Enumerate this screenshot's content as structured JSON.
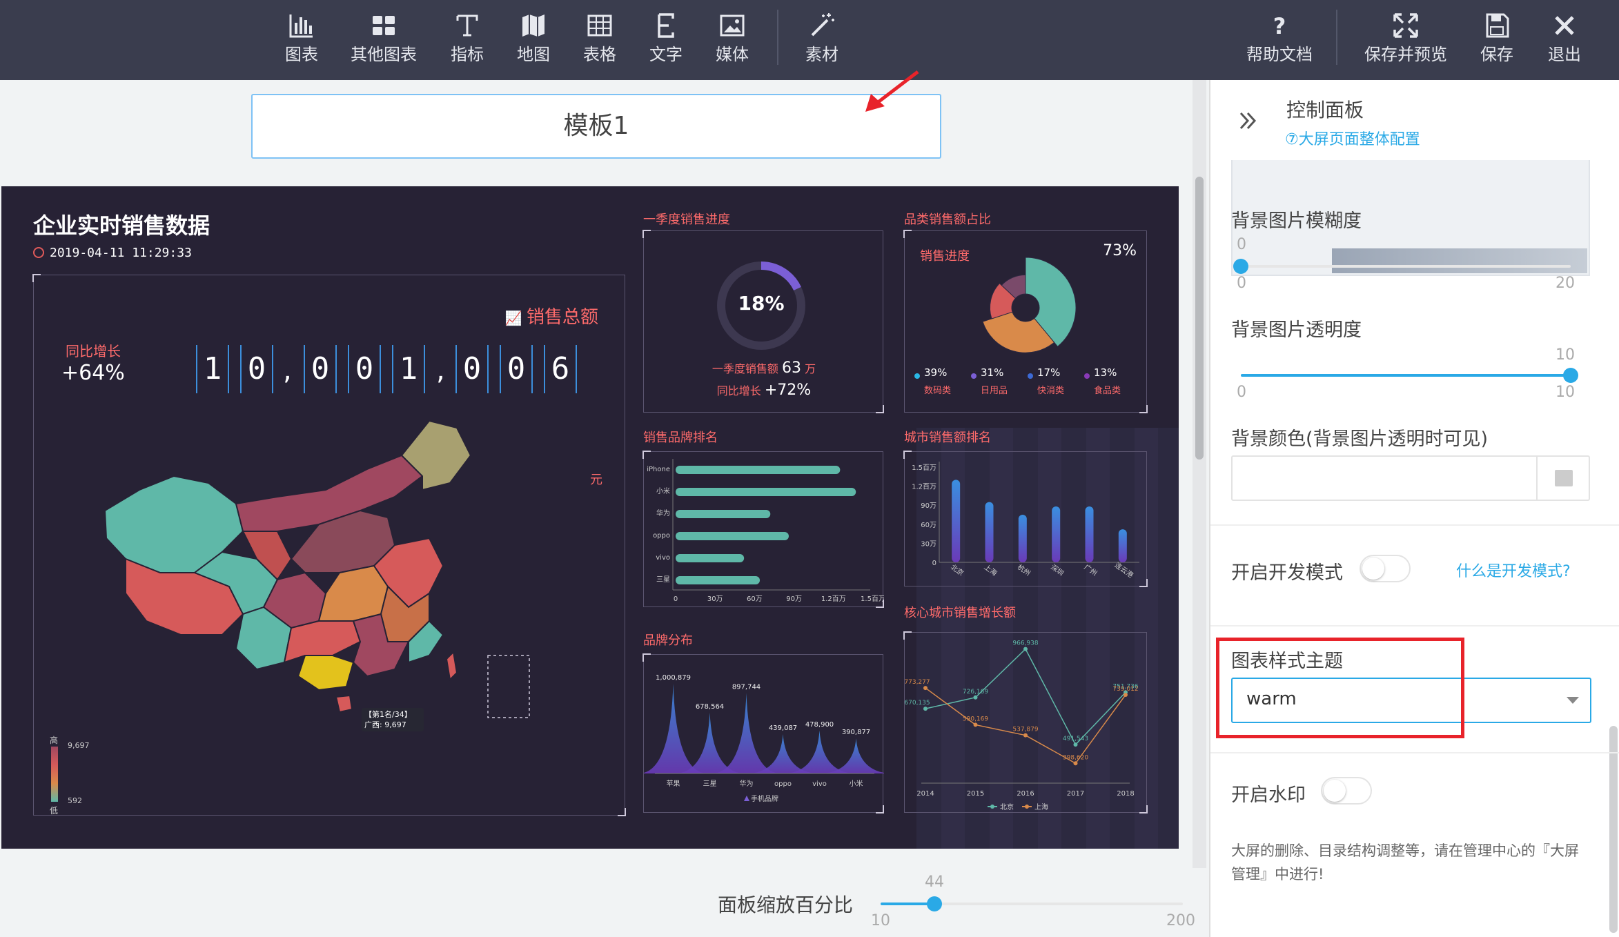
{
  "toolbar": {
    "left_items": [
      {
        "label": "图表",
        "icon": "bar-chart-icon"
      },
      {
        "label": "其他图表",
        "icon": "grid-icon"
      },
      {
        "label": "指标",
        "icon": "text-t-icon"
      },
      {
        "label": "地图",
        "icon": "map-icon"
      },
      {
        "label": "表格",
        "icon": "table-icon"
      },
      {
        "label": "文字",
        "icon": "text-e-icon"
      },
      {
        "label": "媒体",
        "icon": "image-icon"
      },
      {
        "label": "素材",
        "icon": "magic-wand-icon"
      }
    ],
    "right_items": [
      {
        "label": "帮助文档",
        "icon": "question-icon"
      },
      {
        "label": "保存并预览",
        "icon": "expand-icon"
      },
      {
        "label": "保存",
        "icon": "save-icon"
      },
      {
        "label": "退出",
        "icon": "close-icon"
      }
    ]
  },
  "template_title": "模板1",
  "screen": {
    "title": "企业实时销售数据",
    "timestamp": "2019-04-11 11:29:33",
    "sales_total_label": "销售总额",
    "growth_label": "同比增长",
    "growth_value": "+64%",
    "digits": [
      "1",
      "0",
      "0",
      "0",
      "1",
      "0",
      "0",
      "6"
    ],
    "commas": [
      ",",
      ","
    ],
    "unit": "元",
    "map_legend": {
      "high_label": "高",
      "low_label": "低",
      "max": "9,697",
      "min": "592"
    },
    "map_tooltip": {
      "rank": "【第1名/34】",
      "value": "广西: 9,697"
    },
    "q1": {
      "title": "一季度销售进度",
      "percent_text": "18%",
      "percent": 18,
      "sales_label": "一季度销售额",
      "sales_value": "63",
      "sales_unit": "万",
      "growth_label": "同比增长",
      "growth_value": "+72%"
    },
    "category": {
      "title": "品类销售额占比",
      "progress_label": "销售进度",
      "progress_value": "73%",
      "items": [
        {
          "pct": "39%",
          "name": "数码类",
          "value": 39,
          "color": "#5fb8a8"
        },
        {
          "pct": "31%",
          "name": "日用品",
          "value": 31,
          "color": "#d98a4a"
        },
        {
          "pct": "17%",
          "name": "快消类",
          "value": 17,
          "color": "#d65a5a"
        },
        {
          "pct": "13%",
          "name": "食品类",
          "value": 13,
          "color": "#7a4a6a"
        }
      ]
    },
    "brand_rank": {
      "title": "销售品牌排名",
      "brands": [
        "iPhone",
        "小米",
        "华为",
        "oppo",
        "vivo",
        "三星"
      ],
      "values": [
        1.25,
        1.37,
        0.72,
        0.86,
        0.52,
        0.64
      ],
      "xticks": [
        "0",
        "30万",
        "60万",
        "90万",
        "1.2百万",
        "1.5百万"
      ],
      "xmax": 1.5
    },
    "city_rank": {
      "title": "城市销售额排名",
      "cities": [
        "北京",
        "上海",
        "杭州",
        "深圳",
        "广州",
        "连云港"
      ],
      "values": [
        1.3,
        0.95,
        0.75,
        0.88,
        0.88,
        0.52
      ],
      "yticks": [
        "0",
        "30万",
        "60万",
        "90万",
        "1.2百万",
        "1.5百万"
      ],
      "ymax": 1.5
    },
    "brand_dist": {
      "title": "品牌分布",
      "brands": [
        "苹果",
        "三星",
        "华为",
        "oppo",
        "vivo",
        "小米"
      ],
      "values": [
        1000879,
        678564,
        897744,
        439087,
        478900,
        390877
      ],
      "labels": [
        "1,000,879",
        "678,564",
        "897,744",
        "439,087",
        "478,900",
        "390,877"
      ],
      "legend": "手机品牌"
    },
    "city_growth": {
      "title": "核心城市销售增长额",
      "years": [
        "2014",
        "2015",
        "2016",
        "2017",
        "2018"
      ],
      "series": [
        {
          "name": "北京",
          "values": [
            670135,
            726169,
            966938,
            491543,
            751736
          ],
          "labels": [
            "670,135",
            "726,169",
            "966,938",
            "491,543",
            "751,736"
          ],
          "color": "#5fb8a8"
        },
        {
          "name": "上海",
          "values": [
            773277,
            590169,
            537879,
            398620,
            739012
          ],
          "labels": [
            "773,277",
            "590,169",
            "537,879",
            "398,620",
            "739,012"
          ],
          "color": "#d98a4a"
        }
      ],
      "ymin": 300000,
      "ymax": 1000000
    }
  },
  "zoom": {
    "label": "面板缩放百分比",
    "value": "44",
    "min": "10",
    "max": "200",
    "v": 44,
    "lo": 10,
    "hi": 200
  },
  "panel": {
    "title": "控制面板",
    "subtitle": "⑦大屏页面整体配置",
    "blur": {
      "label": "背景图片模糊度",
      "value": "0",
      "min": "0",
      "max": "20",
      "v": 0,
      "lo": 0,
      "hi": 20
    },
    "opacity": {
      "label": "背景图片透明度",
      "value": "10",
      "min": "0",
      "max": "10",
      "v": 10,
      "lo": 0,
      "hi": 10
    },
    "bg_color": {
      "label": "背景颜色(背景图片透明时可见)",
      "value": ""
    },
    "dev_mode": {
      "label": "开启开发模式",
      "link": "什么是开发模式?"
    },
    "theme": {
      "label": "图表样式主题",
      "value": "warm"
    },
    "watermark": {
      "label": "开启水印"
    },
    "note": "大屏的删除、目录结构调整等，请在管理中心的『大屏管理』中进行!"
  },
  "colors": {
    "accent": "#2aa9e6",
    "highlight": "#e8232a",
    "toolbar": "#3a3d4e",
    "screen_bg": "#272235"
  }
}
